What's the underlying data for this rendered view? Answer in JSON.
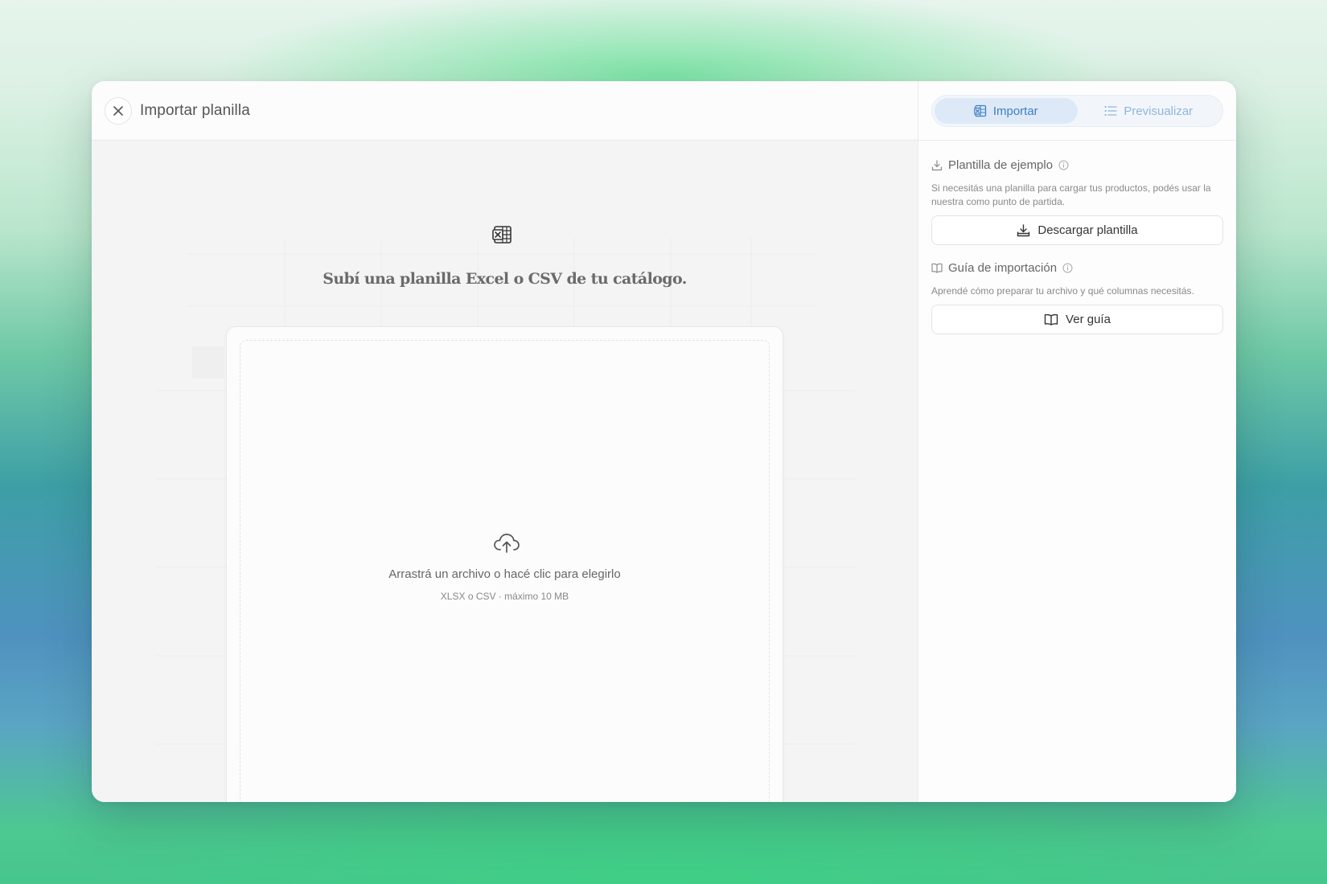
{
  "window": {
    "title": "Importar planilla"
  },
  "tabs": [
    {
      "label": "Importar",
      "active": true,
      "icon": "excel-icon"
    },
    {
      "label": "Previsualizar",
      "active": false,
      "icon": "list-icon"
    }
  ],
  "upload": {
    "headline": "Subí una planilla Excel o CSV de tu catálogo.",
    "drop_text": "Arrastrá un archivo o hacé clic para elegirlo",
    "drop_hint": "XLSX o CSV · máximo 10 MB"
  },
  "template_section": {
    "title": "Plantilla de ejemplo",
    "description": "Si necesitás una planilla para cargar tus productos, podés usar la nuestra como punto de partida.",
    "button_label": "Descargar plantilla"
  },
  "guide_section": {
    "title": "Guía de importación",
    "description": "Aprendé cómo preparar tu archivo y qué columnas necesitás.",
    "button_label": "Ver guía"
  },
  "colors": {
    "accent": "#3d7fc4",
    "accent_light": "#8fb5dc",
    "tab_active_bg": "#dde9f7"
  }
}
